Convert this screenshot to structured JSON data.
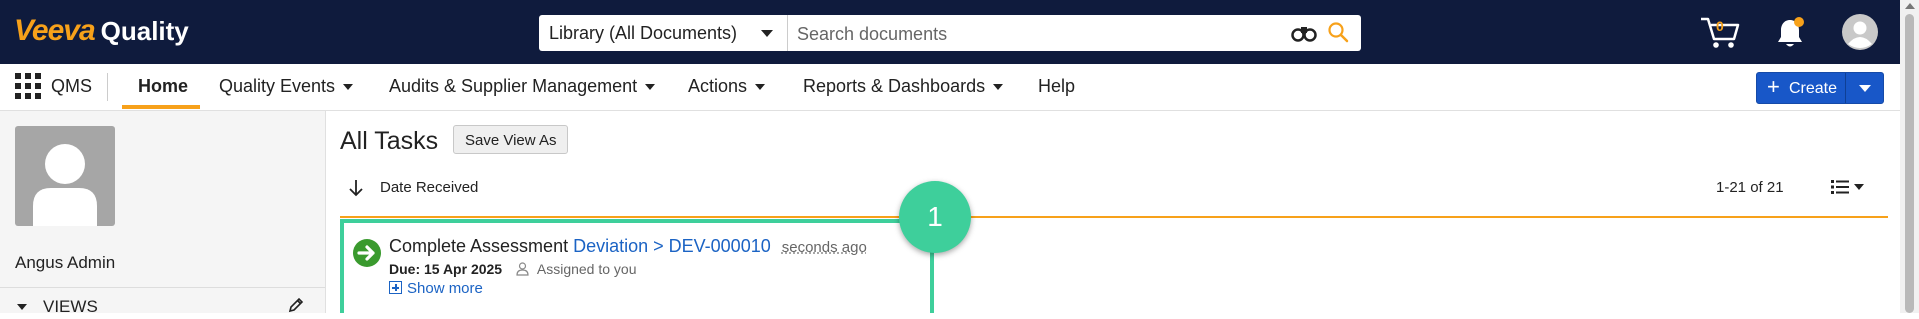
{
  "header": {
    "brand": "Veeva",
    "product": "Quality",
    "search_scope": "Library (All Documents)",
    "search_placeholder": "Search documents",
    "cart_count": "0",
    "accent_color": "#f7a11a",
    "bg_color": "#0f1b3d"
  },
  "nav": {
    "app": "QMS",
    "items": [
      {
        "label": "Home",
        "active": true
      },
      {
        "label": "Quality Events",
        "dropdown": true
      },
      {
        "label": "Audits & Supplier Management",
        "dropdown": true
      },
      {
        "label": "Actions",
        "dropdown": true
      },
      {
        "label": "Reports & Dashboards",
        "dropdown": true
      },
      {
        "label": "Help"
      }
    ],
    "create_label": "Create"
  },
  "sidebar": {
    "user_name": "Angus Admin",
    "views_label": "VIEWS"
  },
  "main": {
    "title": "All Tasks",
    "save_view_label": "Save View As",
    "sort_label": "Date Received",
    "range": "1-21 of 21"
  },
  "task": {
    "action": "Complete Assessment",
    "link": "Deviation > DEV-000010",
    "time": "seconds ago",
    "due": "Due: 15 Apr 2025",
    "assigned": "Assigned to you",
    "show_more": "Show more",
    "status_color": "#3a9a2e"
  },
  "callout": {
    "number": "1",
    "color": "#3ecf9b"
  },
  "icons": [
    "apps-grid-icon",
    "binoculars-icon",
    "search-icon",
    "cart-icon",
    "bell-icon",
    "user-avatar-icon",
    "arrow-down-icon",
    "list-view-icon",
    "pencil-icon",
    "status-arrow-icon",
    "user-icon"
  ]
}
